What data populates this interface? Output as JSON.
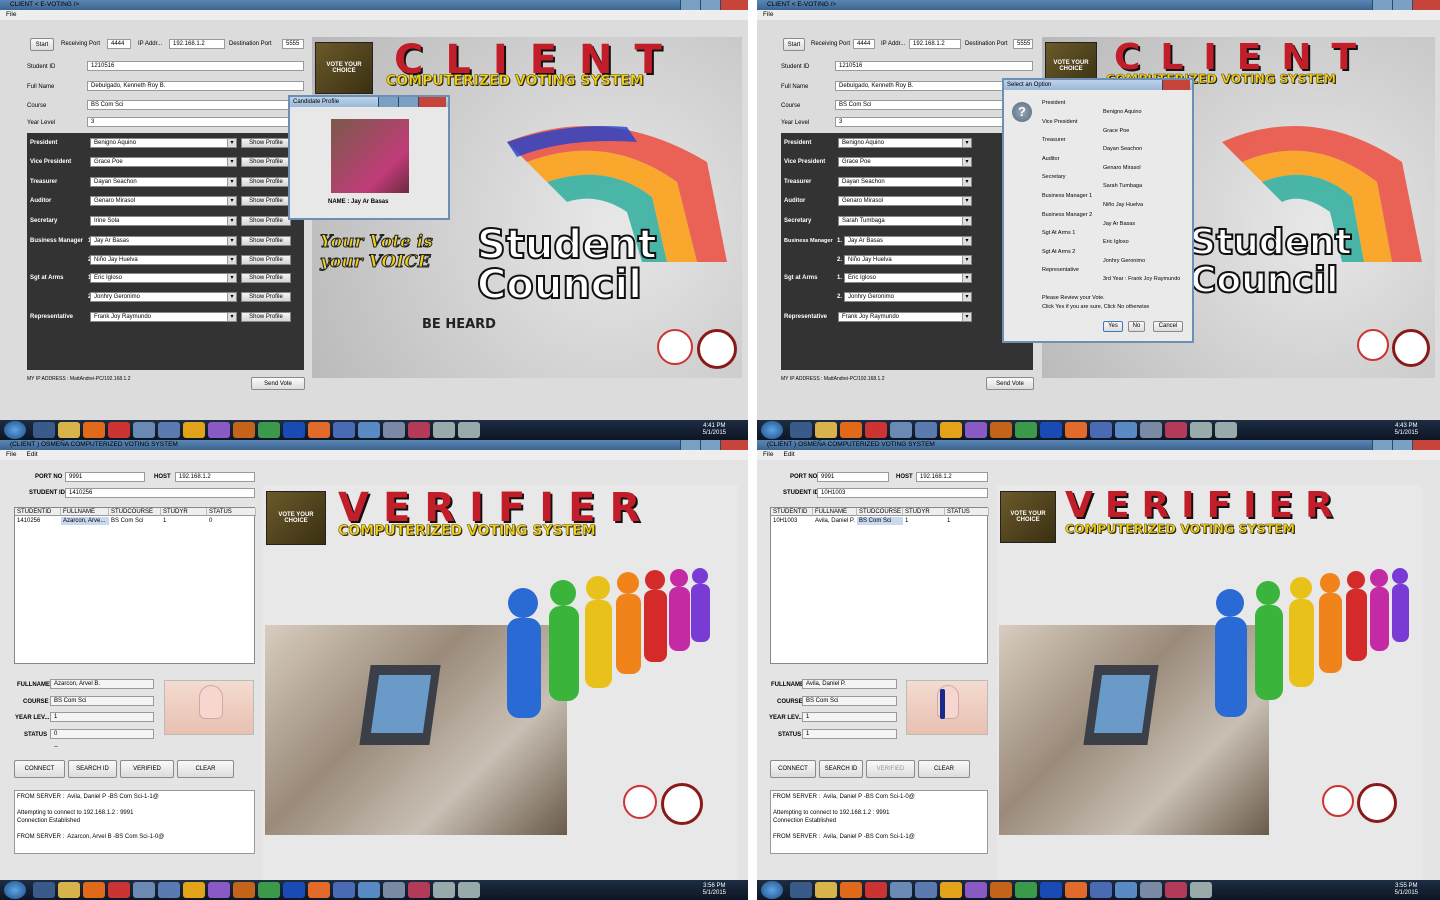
{
  "client": {
    "title": "CLIENT   < E-VOTING />",
    "menu_file": "File",
    "start": "Start",
    "receiving_port_label": "Receiving Port",
    "receiving_port": "4444",
    "ip_label": "IP Addr...",
    "ip": "192.168.1.2",
    "dest_port_label": "Destination Port",
    "dest_port": "5555",
    "student_id_label": "Student ID",
    "student_id": "1210516",
    "fullname_label": "Full Name",
    "fullname": "Debulgado, Kenneth Roy B.",
    "course_label": "Course",
    "course": "BS Com Sci",
    "year_label": "Year Level",
    "year": "3",
    "show_profile": "Show Profile",
    "positions": {
      "president": "President",
      "vp": "Vice President",
      "treasurer": "Treasurer",
      "auditor": "Auditor",
      "secretary": "Secretary",
      "bm": "Business Manager",
      "sgt": "Sgt at Arms",
      "rep": "Representative"
    },
    "n1": "1.",
    "n2": "2.",
    "sel_a": {
      "president": "Benigno Aquino",
      "vp": "Grace Poe",
      "treasurer": "Dayan Seachon",
      "auditor": "Genaro Mirasol",
      "secretary": "Irine Sola",
      "bm1": "Jay Ar Basas",
      "bm2": "Niño Jay Huelva",
      "sgt1": "Eric Igloso",
      "sgt2": "Jonhry Geronimo",
      "rep": "Frank Joy Raymundo"
    },
    "sel_b_secretary": "Sarah Tumbaga",
    "my_ip": "MY IP ADDRESS :  MattAndrei-PC/192.168.1.2",
    "send_vote": "Send Vote",
    "banner_title": "CLIENT",
    "banner_sub": "COMPUTERIZED VOTING SYSTEM",
    "box_text": "VOTE YOUR CHOICE",
    "student": "Student",
    "council": "Council",
    "your_vote": "Your Vote is your VOICE",
    "be_heard": "BE HEARD"
  },
  "profile_dialog": {
    "title": "Candidate Profile",
    "name": "NAME :  Jay Ar Basas"
  },
  "option_dialog": {
    "title": "Select an Option",
    "positions": [
      "President",
      "Vice President",
      "Treasurer",
      "Auditor",
      "Secretary",
      "Business Manager 1",
      "Business Manager 2",
      "Sgt At Arms 1",
      "Sgt At Arms 2",
      "Representative"
    ],
    "names": [
      "Benigno Aquino",
      "Grace Poe",
      "Dayan Seachon",
      "Genaro Mirasol",
      "Sarah Tumbaga",
      "Niño Jay Huelva",
      "Jay Ar Basas",
      "Eric Igloso",
      "Jonhry Geronimo",
      "3rd Year : Frank Joy Raymundo"
    ],
    "msg1": "Please Review your Vote.",
    "msg2": "Click Yes if you are sure, Click No otherwise",
    "yes": "Yes",
    "no": "No",
    "cancel": "Cancel"
  },
  "taskbar": {
    "time1": "4:41 PM",
    "date1": "5/1/2015",
    "time2": "4:43 PM",
    "date2": "5/1/2015",
    "time3": "3:56 PM",
    "date3": "5/1/2015",
    "time4": "3:55 PM",
    "date4": "5/1/2015"
  },
  "verifier": {
    "title": "(CLIENT ) OSMEÑA COMPUTERIZED VOTING SYSTEM",
    "menu_file": "File",
    "menu_edit": "Edit",
    "port_label": "PORT NO",
    "port": "9991",
    "host_label": "HOST",
    "host": "192.168.1.2",
    "sid_label": "STUDENT ID",
    "cols": [
      "STUDENTID",
      "FULLNAME",
      "STUDCOURSE",
      "STUDYR",
      "STATUS"
    ],
    "fullname_label": "FULLNAME",
    "course_label": "COURSE",
    "year_label": "YEAR LEV...",
    "status_label": "STATUS",
    "dash": "--",
    "connect": "CONNECT",
    "search": "SEARCH ID",
    "verified": "VERIFIED",
    "clear": "CLEAR",
    "banner_title": "VERIFIER",
    "banner_sub": "COMPUTERIZED VOTING SYSTEM",
    "box_text": "VOTE YOUR CHOICE",
    "left": {
      "sid": "1410256",
      "row": [
        "1410256",
        "Azarcon, Arve...",
        "BS Com Sci",
        "1",
        "0"
      ],
      "fullname": "Azarcon, Arvel B.",
      "course": "BS Com Sci",
      "year": "1",
      "status": "0",
      "log": "FROM SERVER :  Avila, Daniel P -BS Com Sci-1-1@\n\nAttempting to connect to 192.168.1.2 : 9991\nConnection Established\n\nFROM SERVER :  Azarcon, Arvel B -BS Com Sci-1-0@"
    },
    "right": {
      "sid": "10H1003",
      "row": [
        "10H1003",
        "Avila, Daniel P.",
        "BS Com Sci",
        "1",
        "1"
      ],
      "fullname": "Avila, Daniel P.",
      "course": "BS Com Sci",
      "year": "1",
      "status": "1",
      "log": "FROM SERVER :  Avila, Daniel P -BS Com Sci-1-0@\n\nAttempting to connect to 192.168.1.2 : 9991\nConnection Established\n\nFROM SERVER :  Avila, Daniel P -BS Com Sci-1-1@"
    }
  },
  "colors": {
    "accent_red": "#c21e2a",
    "accent_yellow": "#f2d21a",
    "panel": "#333333",
    "titlebar": "#4a74a2"
  }
}
